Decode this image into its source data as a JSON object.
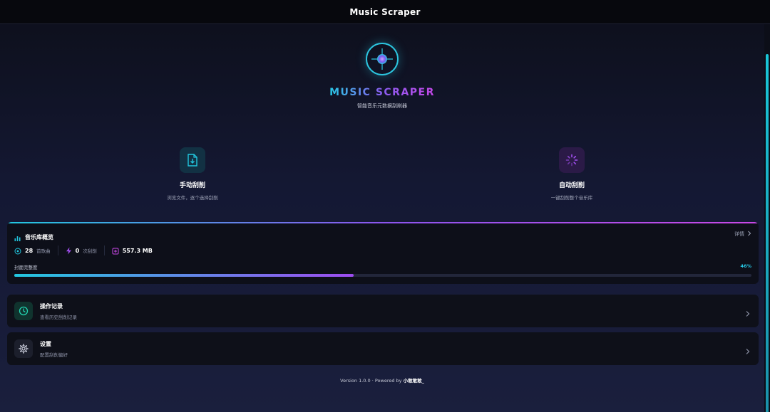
{
  "window": {
    "title": "Music Scraper"
  },
  "hero": {
    "title": "MUSIC SCRAPER",
    "subtitle": "智能音乐元数据刮削器"
  },
  "modes": [
    {
      "title": "手动刮削",
      "desc": "浏览文件，逐个选择刮削",
      "icon": "file-download-icon",
      "color": "#22c7df"
    },
    {
      "title": "自动刮削",
      "desc": "一键刮削整个音乐库",
      "icon": "spinner-icon",
      "color": "#a24ff0"
    }
  ],
  "library": {
    "title": "音乐库概览",
    "detail_label": "详情",
    "stats": [
      {
        "value": "28",
        "label": "首歌曲",
        "icon": "disc-icon"
      },
      {
        "value": "0",
        "label": "次刮削",
        "icon": "bolt-icon"
      },
      {
        "value": "557.3 MB",
        "label": "",
        "icon": "storage-icon"
      }
    ],
    "cover_label": "封面完整度",
    "cover_percent_text": "46%",
    "cover_fraction": 0.46
  },
  "list": [
    {
      "title": "操作记录",
      "desc": "查看历史刮削记录",
      "icon": "clock-icon"
    },
    {
      "title": "设置",
      "desc": "配置刮削偏好",
      "icon": "gear-icon"
    }
  ],
  "footer": {
    "version": "Version 1.0.0 · Powered by",
    "author": "小敢敢敢_"
  },
  "colors": {
    "accent_cyan": "#22c7df",
    "accent_purple": "#a24ff0",
    "accent_pink": "#c948e6"
  }
}
